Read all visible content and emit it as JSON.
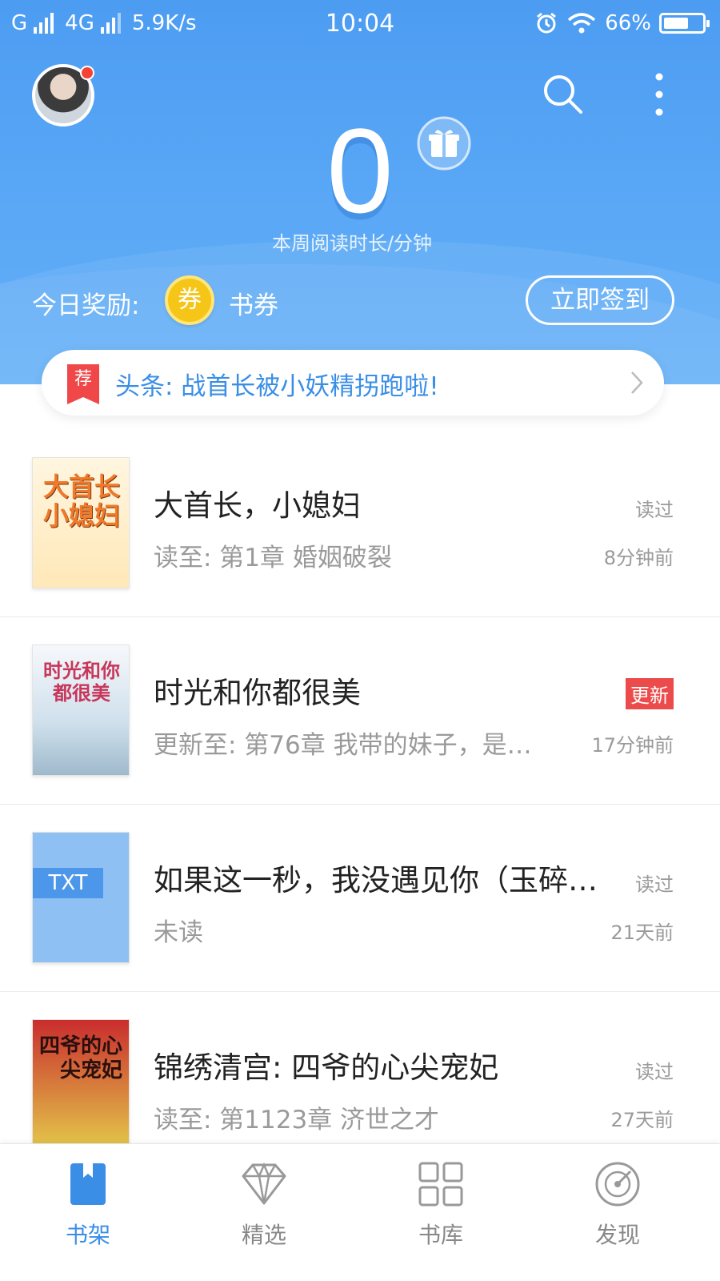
{
  "status_bar": {
    "carrier_g": "G",
    "network": "4G",
    "speed": "5.9K/s",
    "time": "10:04",
    "battery": "66%",
    "battery_level": 0.66
  },
  "header": {
    "reading_minutes": "0",
    "reading_label": "本周阅读时长/分钟",
    "reward_label": "今日奖励:",
    "coupon_icon_text": "券",
    "coupon_text": "书券",
    "signin_button": "立即签到"
  },
  "news": {
    "badge": "荐",
    "text": "头条: 战首长被小妖精拐跑啦!"
  },
  "books": [
    {
      "cover_title": "大首长小媳妇",
      "title": "大首长，小媳妇",
      "subtitle": "读至: 第1章 婚姻破裂",
      "status": "读过",
      "time": "8分钟前"
    },
    {
      "cover_title": "时光和你都很美",
      "title": "时光和你都很美",
      "subtitle": "更新至: 第76章 我带的妹子，是…",
      "status": "更新",
      "time": "17分钟前"
    },
    {
      "cover_title": "TXT",
      "title": "如果这一秒，我没遇见你（玉碎…",
      "subtitle": "未读",
      "status": "读过",
      "time": "21天前"
    },
    {
      "cover_title": "四爷的心尖宠妃",
      "title": "锦绣清宫: 四爷的心尖宠妃",
      "subtitle": "读至: 第1123章 济世之才",
      "status": "读过",
      "time": "27天前"
    }
  ],
  "bottom_nav": [
    {
      "label": "书架",
      "icon": "bookshelf-icon",
      "active": true
    },
    {
      "label": "精选",
      "icon": "diamond-icon",
      "active": false
    },
    {
      "label": "书库",
      "icon": "grid-icon",
      "active": false
    },
    {
      "label": "发现",
      "icon": "compass-icon",
      "active": false
    }
  ],
  "colors": {
    "header_blue": "#4c9cf2",
    "accent_blue": "#3a8ee6",
    "update_red": "#ec4b4b",
    "coupon_gold": "#f5c518"
  }
}
